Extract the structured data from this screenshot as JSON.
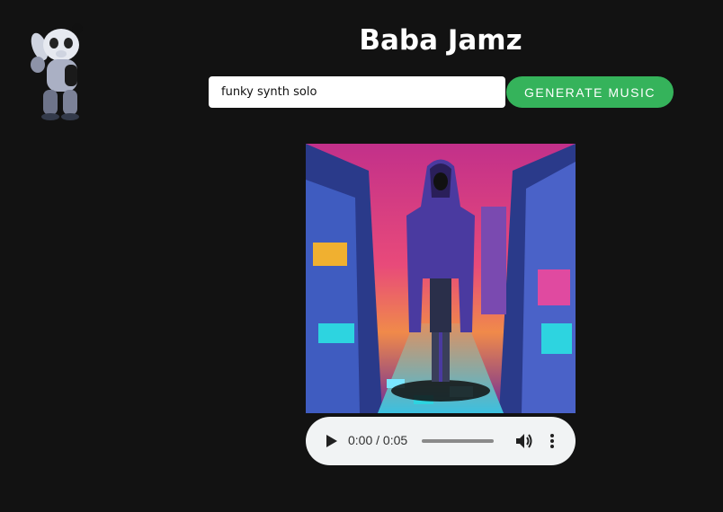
{
  "app": {
    "title": "Baba Jamz"
  },
  "search": {
    "value": "funky synth solo"
  },
  "actions": {
    "generate_label": "GENERATE MUSIC"
  },
  "player": {
    "time": "0:00 / 0:05",
    "progress": 0
  },
  "colors": {
    "background": "#121212",
    "accent": "#35b35b",
    "player_bg": "#f1f3f4"
  },
  "icons": {
    "mascot": "panda-character-logo",
    "play": "play-icon",
    "volume": "volume-icon",
    "more": "more-vertical-icon"
  }
}
